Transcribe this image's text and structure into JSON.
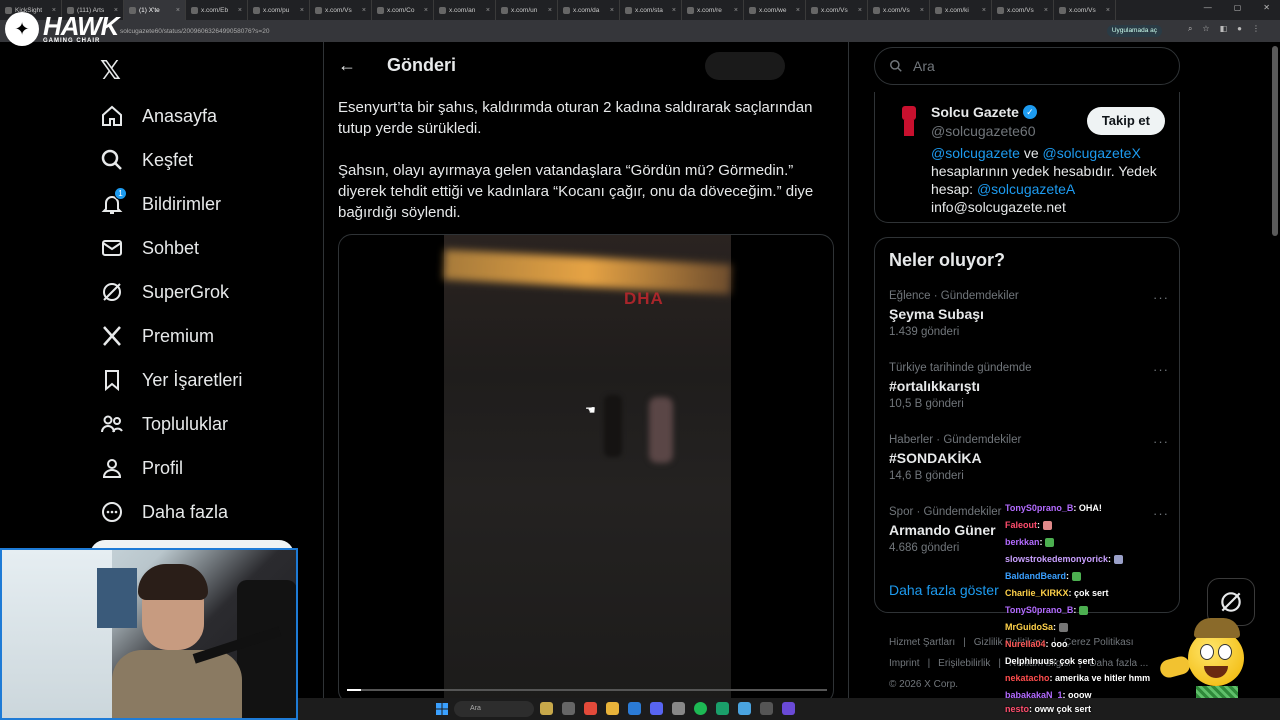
{
  "browser": {
    "tabs": [
      {
        "label": "KickSight"
      },
      {
        "label": "(111) Arts"
      },
      {
        "label": "(1) X'te"
      },
      {
        "label": "x.com/Eb"
      },
      {
        "label": "x.com/pu"
      },
      {
        "label": "x.com/Vs"
      },
      {
        "label": "x.com/Co"
      },
      {
        "label": "x.com/an"
      },
      {
        "label": "x.com/un"
      },
      {
        "label": "x.com/da"
      },
      {
        "label": "x.com/sta"
      },
      {
        "label": "x.com/re"
      },
      {
        "label": "x.com/we"
      },
      {
        "label": "x.com/Vs"
      },
      {
        "label": "x.com/Vs"
      },
      {
        "label": "x.com/ki"
      },
      {
        "label": "x.com/Vs"
      },
      {
        "label": "x.com/Vs"
      }
    ],
    "url": "solcugazete60/status/2009606326499058076?s=20",
    "open_in_app": "Uygulamada aç"
  },
  "overlay": {
    "brand": "HAWK",
    "brand_sub": "GAMING CHAIR"
  },
  "nav": {
    "items": [
      {
        "label": "Anasayfa",
        "icon": "home-icon"
      },
      {
        "label": "Keşfet",
        "icon": "search-icon"
      },
      {
        "label": "Bildirimler",
        "icon": "bell-icon",
        "badge": "1"
      },
      {
        "label": "Sohbet",
        "icon": "mail-icon"
      },
      {
        "label": "SuperGrok",
        "icon": "grok-icon"
      },
      {
        "label": "Premium",
        "icon": "x-logo-icon"
      },
      {
        "label": "Yer İşaretleri",
        "icon": "bookmark-icon"
      },
      {
        "label": "Topluluklar",
        "icon": "people-icon"
      },
      {
        "label": "Profil",
        "icon": "person-icon"
      },
      {
        "label": "Daha fazla",
        "icon": "more-circle-icon"
      }
    ]
  },
  "post": {
    "header_title": "Gönderi",
    "paragraph1": "Esenyurt’ta bir şahıs, kaldırımda oturan 2 kadına saldırarak saçlarından tutup yerde sürükledi.",
    "paragraph2": "Şahsın, olayı ayırmaya gelen vatandaşlara “Gördün mü? Görmedin.” diyerek tehdit ettiği ve kadınlara “Kocanı çağır, onu da döveceğim.” diye bağırdığı söylendi.",
    "video_watermark": "DHA",
    "video_progress": 0.03
  },
  "sidebar": {
    "search_placeholder": "Ara",
    "profile": {
      "name": "Solcu Gazete",
      "handle": "@solcugazete60",
      "follow_label": "Takip et",
      "bio_link1": "@solcugazete",
      "bio_and": " ve ",
      "bio_link2": "@solcugazeteX",
      "bio_text": " hesaplarının yedek hesabıdır. Yedek hesap: ",
      "bio_link3": "@solcugazeteA",
      "bio_email": "info@solcugazete.net"
    },
    "trends_title": "Neler oluyor?",
    "trends": [
      {
        "meta": "Eğlence · Gündemdekiler",
        "name": "Şeyma Subaşı",
        "count": "1.439 gönderi"
      },
      {
        "meta": "Türkiye tarihinde gündemde",
        "name": "#ortalıkkarıştı",
        "count": "10,5 B gönderi"
      },
      {
        "meta": "Haberler · Gündemdekiler",
        "name": "#SONDAKİKA",
        "count": "14,6 B gönderi"
      },
      {
        "meta": "Spor · Gündemdekiler",
        "name": "Armando Güner",
        "count": "4.686 gönderi"
      }
    ],
    "show_more": "Daha fazla göster",
    "footer": {
      "row1": [
        "Hizmet Şartları",
        "Gizlilik Politikası",
        "Çerez Politikası"
      ],
      "row2": [
        "Imprint",
        "Erişilebilirlik",
        "Reklam bilgisi",
        "Daha fazla ..."
      ],
      "copyright": "© 2026 X Corp."
    }
  },
  "chat": {
    "messages": [
      {
        "user": "TonyS0prano_B",
        "text": ": OHA!",
        "color": "#b36bff"
      },
      {
        "user": "Faleout",
        "text": ": ",
        "color": "#ff4d6d",
        "emote": "#e08a8a"
      },
      {
        "user": "berkkan",
        "text": ": ",
        "color": "#b36bff",
        "emote": "#4caf50"
      },
      {
        "user": "slowstrokedemonyorick",
        "text": ": ",
        "color": "#c9a0ff",
        "emote": "#9aa0c8"
      },
      {
        "user": "BaldandBeard",
        "text": ": ",
        "color": "#3aa0ff",
        "emote": "#4caf50"
      },
      {
        "user": "Charlie_KIRKX",
        "text": ": çok sert",
        "color": "#ffd24a"
      },
      {
        "user": "TonyS0prano_B",
        "text": ": ",
        "color": "#b36bff",
        "emote": "#4caf50"
      },
      {
        "user": "MrGuidoSa",
        "text": ": ",
        "color": "#ffd24a",
        "emote": "#777777"
      },
      {
        "user": "Nurella04",
        "text": ": ooo",
        "color": "#ff5a5a"
      },
      {
        "user": "Delphinuus",
        "text": ": çok sert",
        "color": "#ffffff"
      },
      {
        "user": "nekatacho",
        "text": ": amerika ve hitler hmm",
        "color": "#ff4d4d"
      },
      {
        "user": "babakakaN_1",
        "text": ": ooow",
        "color": "#b36bff"
      }
    ],
    "last": {
      "user": "nesto",
      "text": ": oww çok sert",
      "color": "#ff4d6d"
    }
  },
  "taskbar": {
    "search_label": "Ara"
  }
}
